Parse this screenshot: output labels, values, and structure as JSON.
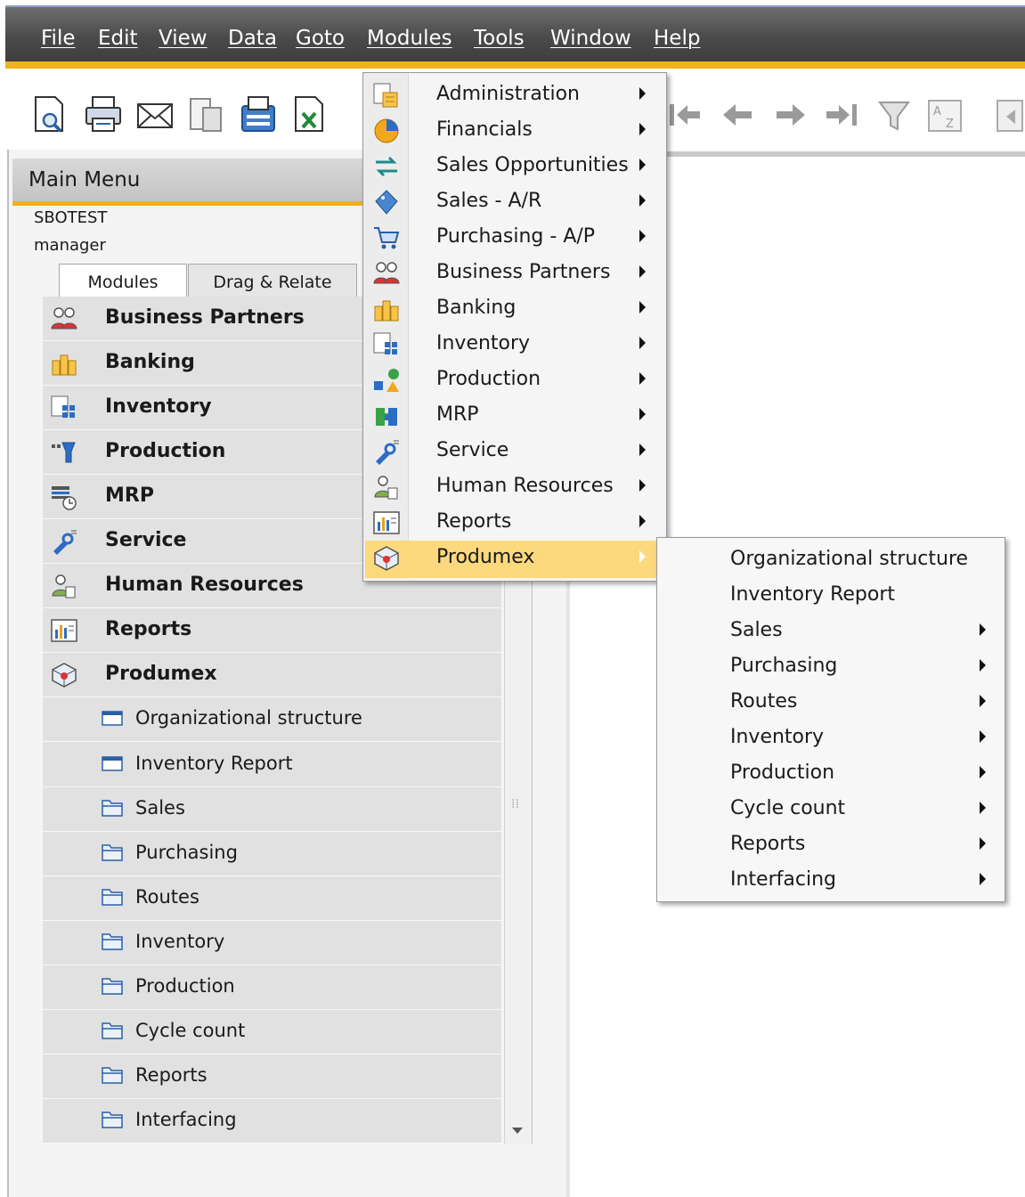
{
  "menubar": {
    "items": [
      {
        "label": "File"
      },
      {
        "label": "Edit"
      },
      {
        "label": "View"
      },
      {
        "label": "Data"
      },
      {
        "label": "Goto"
      },
      {
        "label": "Modules"
      },
      {
        "label": "Tools"
      },
      {
        "label": "Window"
      },
      {
        "label": "Help"
      }
    ]
  },
  "toolbar": {
    "icons": [
      "preview-icon",
      "print-icon",
      "email-icon",
      "sms-icon",
      "fax-icon",
      "excel-export-icon",
      "first-record-icon",
      "previous-record-icon",
      "next-record-icon",
      "last-record-icon",
      "filter-icon",
      "sort-icon",
      "paste-icon"
    ]
  },
  "main_menu": {
    "title": "Main Menu",
    "company": "SBOTEST",
    "user": "manager",
    "tabs": [
      {
        "label": "Modules"
      },
      {
        "label": "Drag & Relate"
      }
    ],
    "items": [
      {
        "label": "Business Partners",
        "icon": "business-partners-icon"
      },
      {
        "label": "Banking",
        "icon": "banking-icon"
      },
      {
        "label": "Inventory",
        "icon": "inventory-icon"
      },
      {
        "label": "Production",
        "icon": "production-icon"
      },
      {
        "label": "MRP",
        "icon": "mrp-icon"
      },
      {
        "label": "Service",
        "icon": "service-icon"
      },
      {
        "label": "Human Resources",
        "icon": "human-resources-icon"
      },
      {
        "label": "Reports",
        "icon": "reports-icon"
      },
      {
        "label": "Produmex",
        "icon": "produmex-icon"
      }
    ],
    "subitems": [
      {
        "label": "Organizational structure",
        "icon": "form-icon"
      },
      {
        "label": "Inventory Report",
        "icon": "form-icon"
      },
      {
        "label": "Sales",
        "icon": "folder-icon"
      },
      {
        "label": "Purchasing",
        "icon": "folder-icon"
      },
      {
        "label": "Routes",
        "icon": "folder-icon"
      },
      {
        "label": "Inventory",
        "icon": "folder-icon"
      },
      {
        "label": "Production",
        "icon": "folder-icon"
      },
      {
        "label": "Cycle count",
        "icon": "folder-icon"
      },
      {
        "label": "Reports",
        "icon": "folder-icon"
      },
      {
        "label": "Interfacing",
        "icon": "folder-icon"
      }
    ]
  },
  "modules_menu": {
    "items": [
      {
        "label": "Administration",
        "icon": "administration-icon"
      },
      {
        "label": "Financials",
        "icon": "financials-icon"
      },
      {
        "label": "Sales Opportunities",
        "icon": "sales-opportunities-icon"
      },
      {
        "label": "Sales - A/R",
        "icon": "sales-ar-icon"
      },
      {
        "label": "Purchasing - A/P",
        "icon": "purchasing-ap-icon"
      },
      {
        "label": "Business Partners",
        "icon": "business-partners-icon"
      },
      {
        "label": "Banking",
        "icon": "banking-icon"
      },
      {
        "label": "Inventory",
        "icon": "inventory-icon"
      },
      {
        "label": "Production",
        "icon": "production-icon"
      },
      {
        "label": "MRP",
        "icon": "mrp-icon"
      },
      {
        "label": "Service",
        "icon": "service-icon"
      },
      {
        "label": "Human Resources",
        "icon": "human-resources-icon"
      },
      {
        "label": "Reports",
        "icon": "reports-icon"
      },
      {
        "label": "Produmex",
        "icon": "produmex-icon"
      }
    ],
    "highlighted": "Produmex"
  },
  "produmex_menu": {
    "items": [
      {
        "label": "Organizational structure",
        "has_submenu": false
      },
      {
        "label": "Inventory Report",
        "has_submenu": false
      },
      {
        "label": "Sales",
        "has_submenu": true
      },
      {
        "label": "Purchasing",
        "has_submenu": true
      },
      {
        "label": "Routes",
        "has_submenu": true
      },
      {
        "label": "Inventory",
        "has_submenu": true
      },
      {
        "label": "Production",
        "has_submenu": true
      },
      {
        "label": "Cycle count",
        "has_submenu": true
      },
      {
        "label": "Reports",
        "has_submenu": true
      },
      {
        "label": "Interfacing",
        "has_submenu": true
      }
    ]
  },
  "colors": {
    "accent": "#f0b21c",
    "highlight": "#fcd97c",
    "menubar": "#4a4a4a"
  }
}
